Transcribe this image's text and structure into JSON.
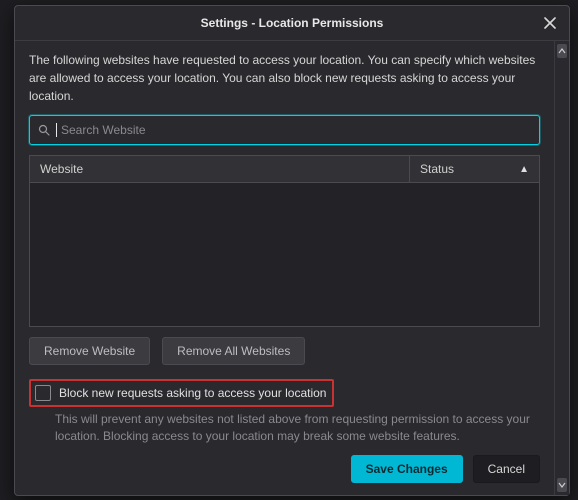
{
  "title": "Settings - Location Permissions",
  "description": "The following websites have requested to access your location. You can specify which websites are allowed to access your location. You can also block new requests asking to access your location.",
  "search": {
    "placeholder": "Search Website"
  },
  "table": {
    "columns": {
      "website": "Website",
      "status": "Status"
    },
    "rows": []
  },
  "buttons": {
    "remove_website": "Remove Website",
    "remove_all": "Remove All Websites",
    "save": "Save Changes",
    "cancel": "Cancel"
  },
  "block_new": {
    "label": "Block new requests asking to access your location",
    "hint": "This will prevent any websites not listed above from requesting permission to access your location. Blocking access to your location may break some website features."
  }
}
